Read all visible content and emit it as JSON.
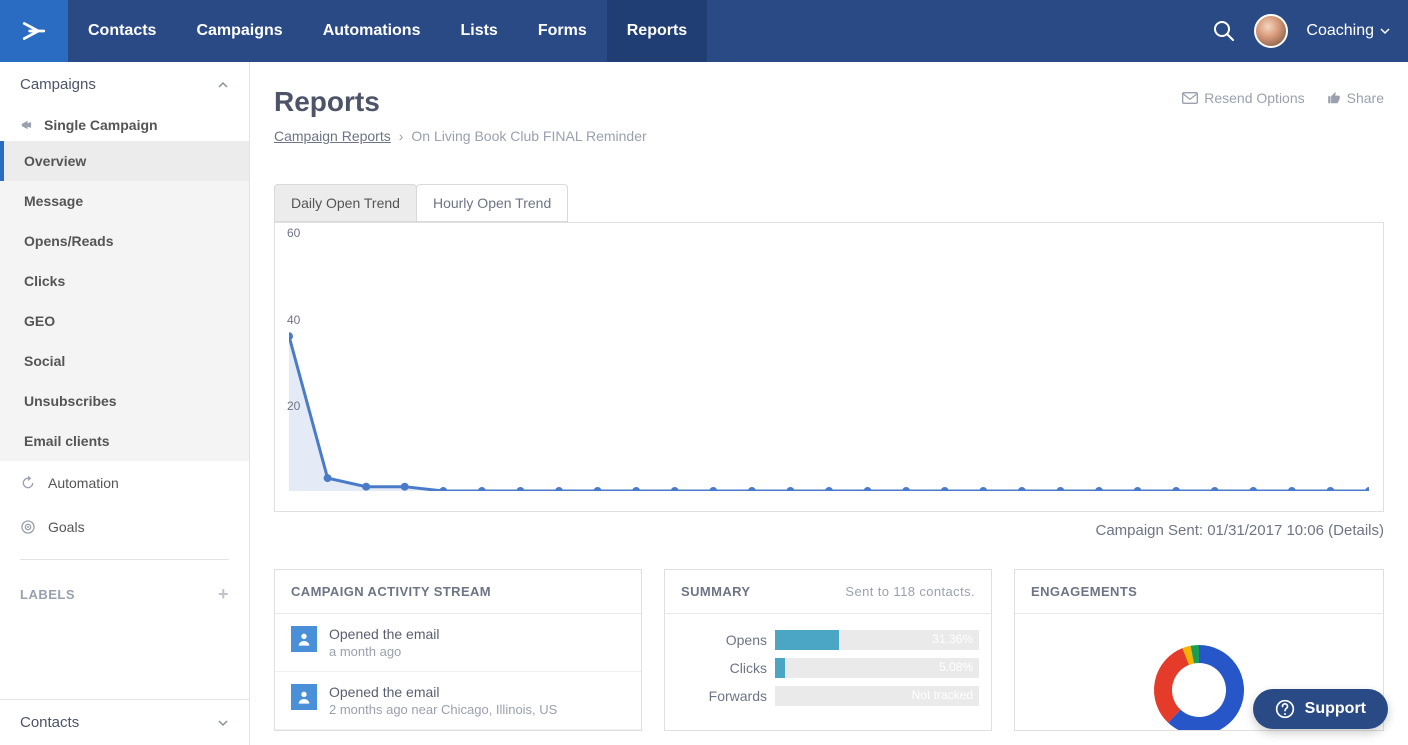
{
  "topnav": {
    "items": [
      "Contacts",
      "Campaigns",
      "Automations",
      "Lists",
      "Forms",
      "Reports"
    ],
    "active_index": 5,
    "user_label": "Coaching"
  },
  "sidebar": {
    "title": "Campaigns",
    "section": "Single Campaign",
    "items": [
      "Overview",
      "Message",
      "Opens/Reads",
      "Clicks",
      "GEO",
      "Social",
      "Unsubscribes",
      "Email clients"
    ],
    "active_index": 0,
    "links": [
      {
        "label": "Automation",
        "icon": "refresh"
      },
      {
        "label": "Goals",
        "icon": "target"
      }
    ],
    "labels_label": "LABELS",
    "bottom_label": "Contacts"
  },
  "page": {
    "title": "Reports",
    "breadcrumb_link": "Campaign Reports",
    "breadcrumb_current": "On Living Book Club FINAL Reminder",
    "resend_label": "Resend Options",
    "share_label": "Share",
    "sent_caption": "Campaign Sent: 01/31/2017 10:06 (Details)"
  },
  "tabs": {
    "items": [
      "Daily Open Trend",
      "Hourly Open Trend"
    ],
    "active_index": 0
  },
  "chart_data": {
    "type": "line",
    "title": "Daily Open Trend",
    "xlabel": "",
    "ylabel": "",
    "ylim": [
      0,
      60
    ],
    "yticks": [
      20,
      40,
      60
    ],
    "x": [
      0,
      1,
      2,
      3,
      4,
      5,
      6,
      7,
      8,
      9,
      10,
      11,
      12,
      13,
      14,
      15,
      16,
      17,
      18,
      19,
      20,
      21,
      22,
      23,
      24,
      25,
      26,
      27,
      28
    ],
    "values": [
      36,
      3,
      1,
      1,
      0,
      0,
      0,
      0,
      0,
      0,
      0,
      0,
      0,
      0,
      0,
      0,
      0,
      0,
      0,
      0,
      0,
      0,
      0,
      0,
      0,
      0,
      0,
      0,
      0
    ],
    "line_color": "#4a7bc9",
    "fill_color": "rgba(74,123,201,0.15)"
  },
  "activity": {
    "title": "CAMPAIGN ACTIVITY STREAM",
    "rows": [
      {
        "text": "Opened the email",
        "meta": "a month ago"
      },
      {
        "text": "Opened the email",
        "meta": "2 months ago  near Chicago, Illinois, US"
      }
    ]
  },
  "summary": {
    "title": "SUMMARY",
    "subtitle": "Sent to 118 contacts.",
    "rows": [
      {
        "label": "Opens",
        "value": "31.36%",
        "pct": 31.36,
        "color": "#4aa6c4"
      },
      {
        "label": "Clicks",
        "value": "5.08%",
        "pct": 5.08,
        "color": "#4aa6c4"
      },
      {
        "label": "Forwards",
        "value": "Not tracked",
        "pct": 0,
        "color": "#4aa6c4"
      }
    ]
  },
  "engagements": {
    "title": "ENGAGEMENTS",
    "segments": [
      {
        "color": "#2656c8",
        "pct": 62
      },
      {
        "color": "#e43b2a",
        "pct": 32
      },
      {
        "color": "#f5b400",
        "pct": 3
      },
      {
        "color": "#1a9e55",
        "pct": 3
      }
    ]
  },
  "support": {
    "label": "Support"
  }
}
